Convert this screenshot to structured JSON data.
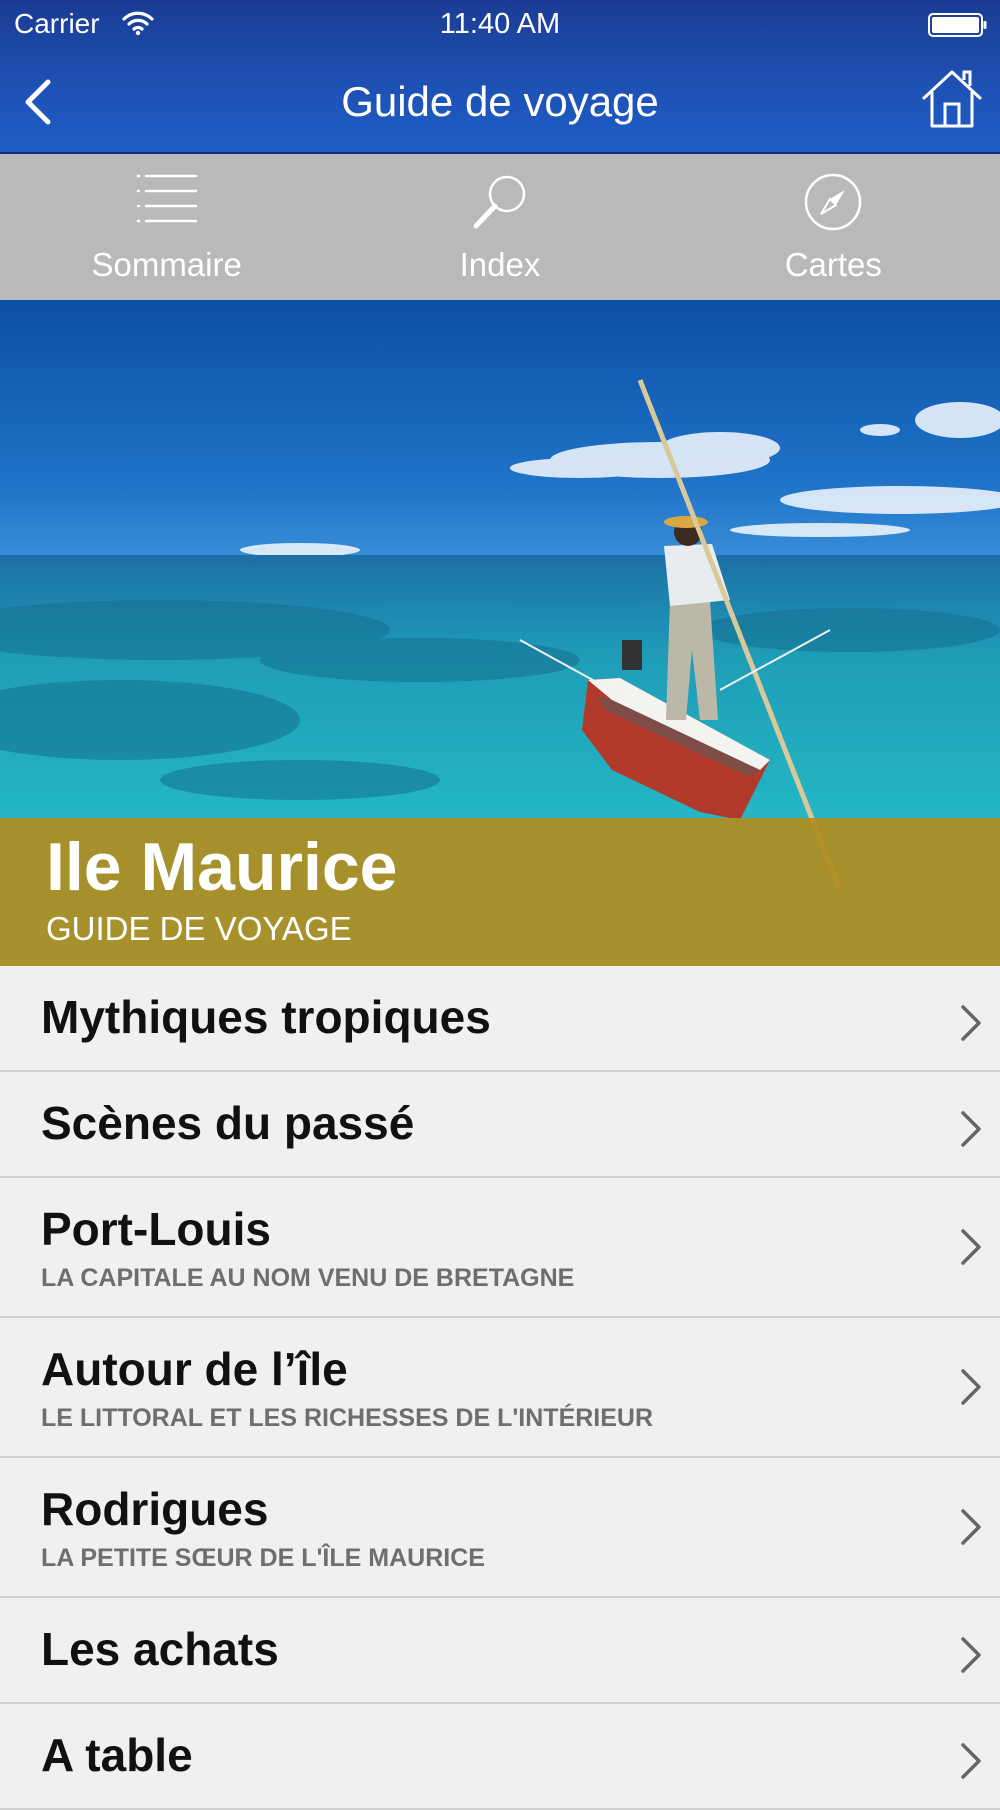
{
  "status_bar": {
    "carrier": "Carrier",
    "time": "11:40 AM"
  },
  "nav": {
    "title": "Guide de voyage",
    "back_icon": "chevron-left-icon",
    "home_icon": "home-icon"
  },
  "toolbar": {
    "items": [
      {
        "label": "Sommaire",
        "icon": "list-icon"
      },
      {
        "label": "Index",
        "icon": "magnifier-icon"
      },
      {
        "label": "Cartes",
        "icon": "compass-icon"
      }
    ]
  },
  "hero": {
    "title": "Ile Maurice",
    "subtitle": "GUIDE DE VOYAGE"
  },
  "list": {
    "items": [
      {
        "title": "Mythiques tropiques",
        "subtitle": ""
      },
      {
        "title": "Scènes du passé",
        "subtitle": ""
      },
      {
        "title": "Port-Louis",
        "subtitle": "LA CAPITALE AU NOM VENU DE BRETAGNE"
      },
      {
        "title": "Autour de l’île",
        "subtitle": "LE LITTORAL ET LES RICHESSES DE L'INTÉRIEUR"
      },
      {
        "title": "Rodrigues",
        "subtitle": "LA PETITE SŒUR DE L'ÎLE MAURICE"
      },
      {
        "title": "Les achats",
        "subtitle": ""
      },
      {
        "title": "A table",
        "subtitle": ""
      }
    ]
  },
  "colors": {
    "header_blue": "#1e52b6",
    "toolbar_gray": "#b9b9b9",
    "banner_gold": "#b08c1e",
    "list_bg": "#f0f0f0"
  }
}
